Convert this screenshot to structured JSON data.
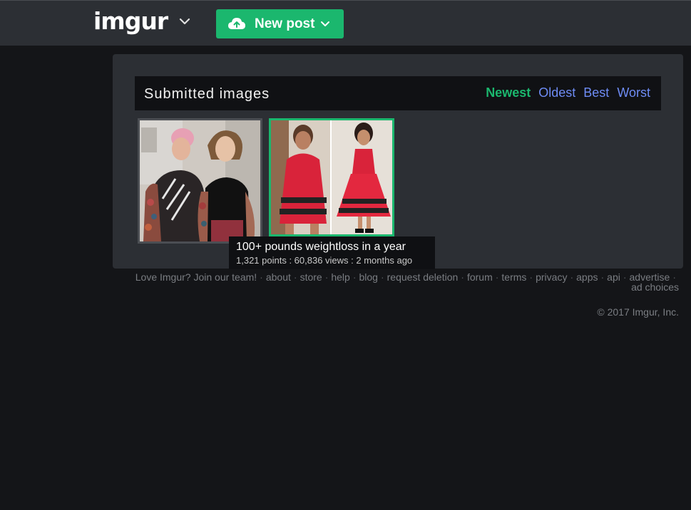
{
  "header": {
    "logo_text": "imgur",
    "new_post_label": "New post"
  },
  "submitted": {
    "title": "Submitted images",
    "sort_options": [
      "Newest",
      "Oldest",
      "Best",
      "Worst"
    ],
    "active_sort": "Newest"
  },
  "tooltip": {
    "title": "100+ pounds weightloss in a year",
    "stats": "1,321 points : 60,836 views : 2 months ago"
  },
  "footer": {
    "links": [
      "Love Imgur? Join our team!",
      "about",
      "store",
      "help",
      "blog",
      "request deletion",
      "forum",
      "terms",
      "privacy",
      "apps",
      "api",
      "advertise",
      "ad choices"
    ],
    "copyright": "© 2017 Imgur, Inc."
  },
  "colors": {
    "accent_green": "#1bb76e",
    "link_blue": "#6e8cf5",
    "header_bg": "#2c2f34",
    "page_bg": "#141518"
  }
}
